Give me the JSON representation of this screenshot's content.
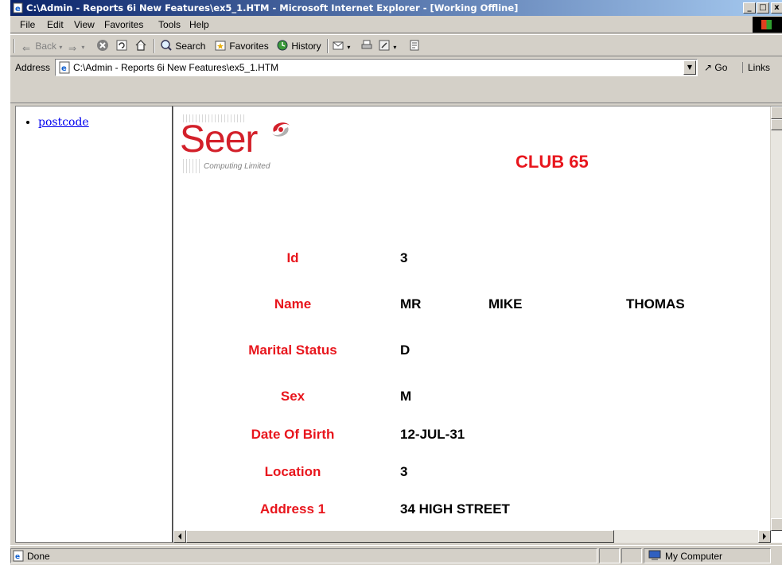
{
  "window": {
    "title": "C:\\Admin - Reports 6i New Features\\ex5_1.HTM - Microsoft Internet Explorer - [Working Offline]",
    "controls": {
      "minimize": "_",
      "maximize": "□",
      "close": "x"
    }
  },
  "menu": {
    "items": [
      "File",
      "Edit",
      "View",
      "Favorites",
      "Tools",
      "Help"
    ]
  },
  "toolbar": {
    "back_label": "Back",
    "search_label": "Search",
    "favorites_label": "Favorites",
    "history_label": "History"
  },
  "address": {
    "label": "Address",
    "value": "C:\\Admin - Reports 6i New Features\\ex5_1.HTM",
    "go_label": "Go",
    "links_label": "Links"
  },
  "nav_frame": {
    "links": [
      "postcode"
    ]
  },
  "report": {
    "logo_text": "Seer",
    "logo_subtitle": "Computing Limited",
    "title": "CLUB 65",
    "fields": [
      {
        "label": "Id",
        "values": [
          "3"
        ]
      },
      {
        "label": "Name",
        "values": [
          "MR",
          "MIKE",
          "THOMAS"
        ]
      },
      {
        "label": "Marital Status",
        "values": [
          "D"
        ]
      },
      {
        "label": "Sex",
        "values": [
          "M"
        ]
      },
      {
        "label": "Date Of Birth",
        "values": [
          "12-JUL-31"
        ]
      },
      {
        "label": "Location",
        "values": [
          "3"
        ]
      },
      {
        "label": "Address 1",
        "values": [
          "34 HIGH STREET"
        ]
      }
    ]
  },
  "status": {
    "text": "Done",
    "zone": "My Computer"
  },
  "colors": {
    "title_bar_start": "#0a246a",
    "title_bar_end": "#a6caf0",
    "report_red": "#e8161d",
    "link_blue": "#0000ee",
    "chrome": "#d4d0c8"
  }
}
